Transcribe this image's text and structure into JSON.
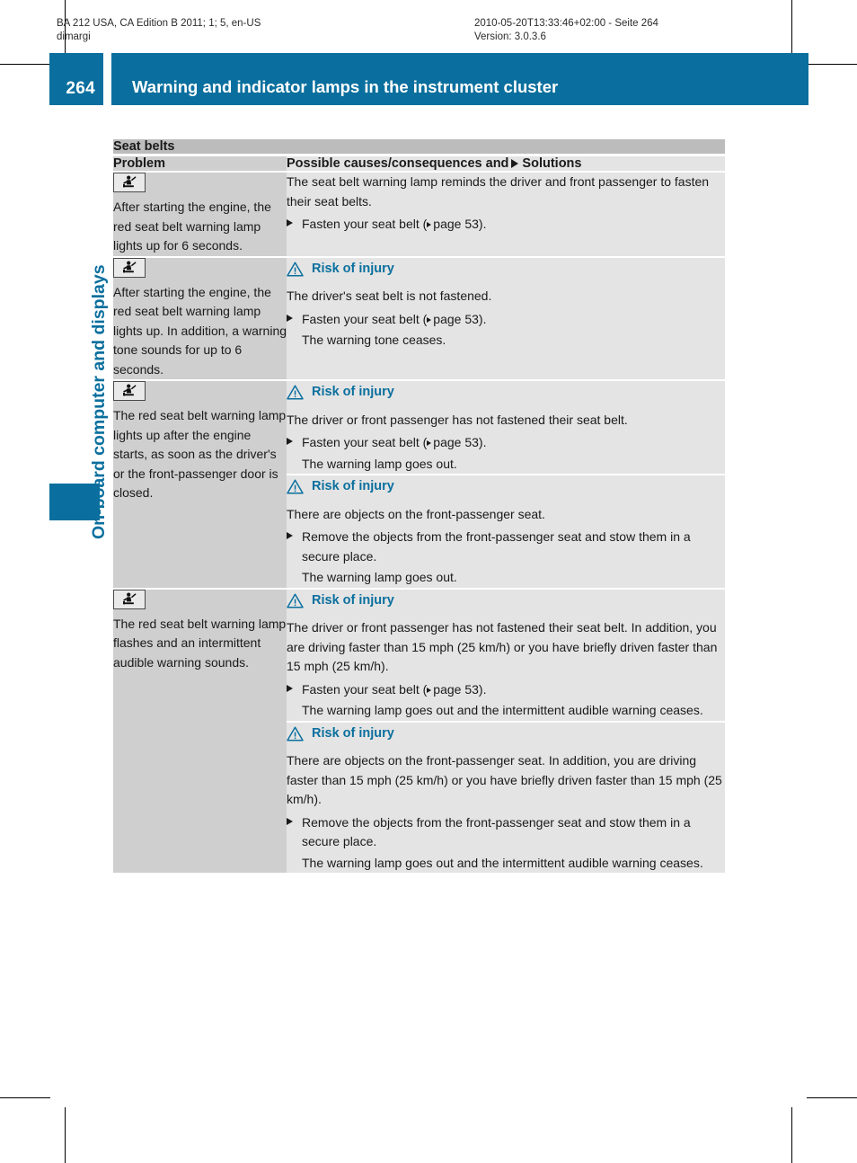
{
  "print_meta": {
    "left": "BA 212 USA, CA Edition B 2011; 1; 5, en-US\ndimargi",
    "right": "2010-05-20T13:33:46+02:00 - Seite 264\nVersion: 3.0.3.6"
  },
  "header": {
    "page_number": "264",
    "title": "Warning and indicator lamps in the instrument cluster",
    "accent_color": "#0a6f9e"
  },
  "chapter": {
    "label": "On-board computer and displays"
  },
  "table": {
    "section_title": "Seat belts",
    "columns": {
      "problem": "Problem",
      "solutions_prefix": "Possible causes/consequences and",
      "solutions_suffix": "Solutions"
    },
    "rows": [
      {
        "icon": "seat-belt-warning-lamp-icon",
        "problem": "After starting the engine, the red seat belt warning lamp lights up for 6 seconds.",
        "blocks": [
          {
            "warning": null,
            "cause": "The seat belt warning lamp reminds the driver and front passenger to fasten their seat belts.",
            "steps": [
              {
                "action": "Fasten your seat belt (",
                "ref": "page 53",
                "after": ").",
                "result": null
              }
            ]
          }
        ]
      },
      {
        "icon": "seat-belt-warning-lamp-icon",
        "problem": "After starting the engine, the red seat belt warning lamp lights up. In addition, a warning tone sounds for up to 6 seconds.",
        "blocks": [
          {
            "warning": "Risk of injury",
            "cause": "The driver's seat belt is not fastened.",
            "steps": [
              {
                "action": "Fasten your seat belt (",
                "ref": "page 53",
                "after": ").",
                "result": "The warning tone ceases."
              }
            ]
          }
        ]
      },
      {
        "icon": "seat-belt-warning-lamp-icon",
        "problem": "The red seat belt warning lamp lights up after the engine starts, as soon as the driver's or the front-passenger door is closed.",
        "blocks": [
          {
            "warning": "Risk of injury",
            "cause": "The driver or front passenger has not fastened their seat belt.",
            "steps": [
              {
                "action": "Fasten your seat belt (",
                "ref": "page 53",
                "after": ").",
                "result": "The warning lamp goes out."
              }
            ]
          },
          {
            "warning": "Risk of injury",
            "cause": "There are objects on the front-passenger seat.",
            "steps": [
              {
                "action": "Remove the objects from the front-passenger seat and stow them in a secure place.",
                "ref": null,
                "after": "",
                "result": "The warning lamp goes out."
              }
            ]
          }
        ]
      },
      {
        "icon": "seat-belt-warning-lamp-icon",
        "problem": "The red seat belt warning lamp flashes and an intermittent audible warning sounds.",
        "blocks": [
          {
            "warning": "Risk of injury",
            "cause": "The driver or front passenger has not fastened their seat belt. In addition, you are driving faster than 15 mph (25 km/h) or you have briefly driven faster than 15 mph (25 km/h).",
            "steps": [
              {
                "action": "Fasten your seat belt (",
                "ref": "page 53",
                "after": ").",
                "result": "The warning lamp goes out and the intermittent audible warning ceases."
              }
            ]
          },
          {
            "warning": "Risk of injury",
            "cause": "There are objects on the front-passenger seat. In addition, you are driving faster than 15 mph (25 km/h) or you have briefly driven faster than 15 mph (25 km/h).",
            "steps": [
              {
                "action": "Remove the objects from the front-passenger seat and stow them in a secure place.",
                "ref": null,
                "after": "",
                "result": "The warning lamp goes out and the intermittent audible warning ceases."
              }
            ]
          }
        ]
      }
    ]
  }
}
